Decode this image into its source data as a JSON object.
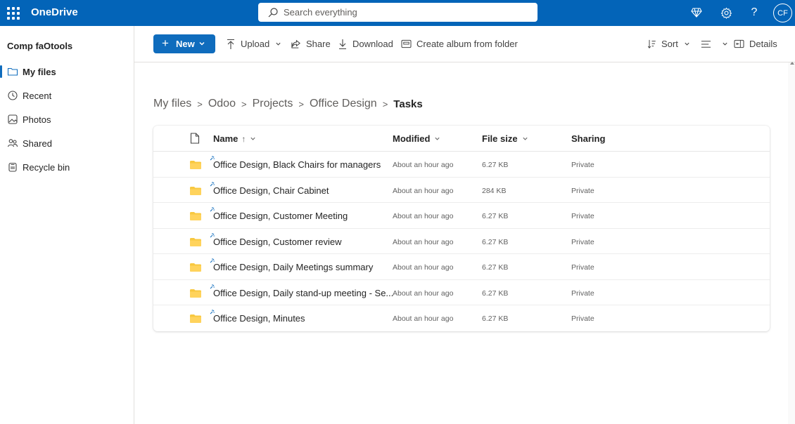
{
  "topbar": {
    "app_name": "OneDrive",
    "search_placeholder": "Search everything",
    "avatar_initials": "CF",
    "color": "#0364b8"
  },
  "sidebar": {
    "account": "Comp faOtools",
    "items": [
      {
        "label": "My files",
        "icon": "folder-icon",
        "active": true
      },
      {
        "label": "Recent",
        "icon": "clock-icon"
      },
      {
        "label": "Photos",
        "icon": "image-icon"
      },
      {
        "label": "Shared",
        "icon": "people-icon"
      },
      {
        "label": "Recycle bin",
        "icon": "trash-icon"
      }
    ]
  },
  "toolbar": {
    "new_label": "New",
    "upload_label": "Upload",
    "share_label": "Share",
    "download_label": "Download",
    "album_label": "Create album from folder",
    "sort_label": "Sort",
    "details_label": "Details"
  },
  "breadcrumb": {
    "items": [
      "My files",
      "Odoo",
      "Projects",
      "Office Design"
    ],
    "current": "Tasks"
  },
  "table": {
    "headers": {
      "name": "Name",
      "name_sort": "↑",
      "modified": "Modified",
      "size": "File size",
      "sharing": "Sharing"
    },
    "rows": [
      {
        "name": "Office Design,  Black Chairs for managers",
        "modified": "About an hour ago",
        "size": "6.27 KB",
        "sharing": "Private"
      },
      {
        "name": "Office Design,  Chair Cabinet",
        "modified": "About an hour ago",
        "size": "284 KB",
        "sharing": "Private"
      },
      {
        "name": "Office Design,  Customer Meeting",
        "modified": "About an hour ago",
        "size": "6.27 KB",
        "sharing": "Private"
      },
      {
        "name": "Office Design,  Customer review",
        "modified": "About an hour ago",
        "size": "6.27 KB",
        "sharing": "Private"
      },
      {
        "name": "Office Design,  Daily Meetings summary",
        "modified": "About an hour ago",
        "size": "6.27 KB",
        "sharing": "Private"
      },
      {
        "name": "Office Design,  Daily stand-up meeting - Se...",
        "modified": "About an hour ago",
        "size": "6.27 KB",
        "sharing": "Private"
      },
      {
        "name": "Office Design,  Minutes",
        "modified": "About an hour ago",
        "size": "6.27 KB",
        "sharing": "Private"
      }
    ]
  },
  "colors": {
    "accent": "#0f6cbd",
    "folder": "#ffc83d"
  }
}
